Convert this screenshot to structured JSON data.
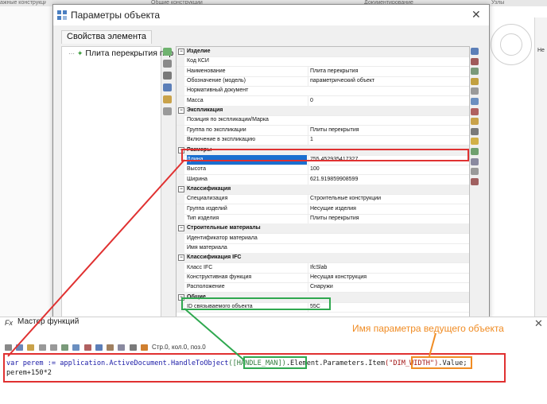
{
  "background": {
    "tabs": [
      "ажные конструкции",
      "Общие конструкции",
      "Документирование",
      "Узлы"
    ],
    "right_panel_label": "Не"
  },
  "dialog": {
    "title": "Параметры объекта",
    "close": "✕",
    "tab": "Свойства элемента",
    "tree_item": "Плита перекрытия пар"
  },
  "properties": [
    {
      "type": "category",
      "label": "Изделие"
    },
    {
      "type": "row",
      "key": "Код КСИ",
      "value": ""
    },
    {
      "type": "row",
      "key": "Наименование",
      "value": "Плита перекрытия"
    },
    {
      "type": "row",
      "key": "Обозначение (модель)",
      "value": "параметрический объект"
    },
    {
      "type": "row",
      "key": "Нормативный документ",
      "value": ""
    },
    {
      "type": "row",
      "key": "Масса",
      "value": "0"
    },
    {
      "type": "category",
      "label": "Экспликация"
    },
    {
      "type": "row",
      "key": "Позиция по экспликации/Марка",
      "value": ""
    },
    {
      "type": "row",
      "key": "Группа по экспликации",
      "value": "Плиты перекрытия"
    },
    {
      "type": "row",
      "key": "Включение в экспликацию",
      "value": "1"
    },
    {
      "type": "category",
      "label": "Размеры"
    },
    {
      "type": "row",
      "key": "Длина",
      "value": "755.452935417327",
      "selected": true
    },
    {
      "type": "row",
      "key": "Высота",
      "value": "100"
    },
    {
      "type": "row",
      "key": "Ширина",
      "value": "621.919859908599"
    },
    {
      "type": "category",
      "label": "Классификация"
    },
    {
      "type": "row",
      "key": "Специализация",
      "value": "Строительные конструкции"
    },
    {
      "type": "row",
      "key": "Группа изделий",
      "value": "Несущие изделия"
    },
    {
      "type": "row",
      "key": "Тип изделия",
      "value": "Плиты перекрытия"
    },
    {
      "type": "category",
      "label": "Строительные материалы"
    },
    {
      "type": "row",
      "key": "Идентификатор материала",
      "value": ""
    },
    {
      "type": "row",
      "key": "Имя материала",
      "value": ""
    },
    {
      "type": "category",
      "label": "Классификация IFC"
    },
    {
      "type": "row",
      "key": "Класс IFC",
      "value": "IfcSlab"
    },
    {
      "type": "row",
      "key": "Конструктивная функция",
      "value": "Несущая конструкция"
    },
    {
      "type": "row",
      "key": "Расположение",
      "value": "Снаружи"
    },
    {
      "type": "category",
      "label": "Общие"
    },
    {
      "type": "row",
      "key": "ID связываемого объекта",
      "value": "55C"
    }
  ],
  "wizard": {
    "title": "Мастер функций",
    "close": "✕",
    "status": "Стр.0, кол.0, поз.0",
    "code_prefix": "var perem := application.ActiveDocument.HandleToObject",
    "code_param1": "([HANDLE_MAN])",
    "code_mid": ".Element.Parameters.Item",
    "code_param2": "(\"DIM_WIDTH\")",
    "code_suffix": ".Value;",
    "code_line2": "perem+150*2"
  },
  "annotation": {
    "label": "Имя параметра ведущего объекта",
    "colors": {
      "red": "#e03131",
      "green": "#2fa84f",
      "orange": "#f08c24"
    }
  }
}
